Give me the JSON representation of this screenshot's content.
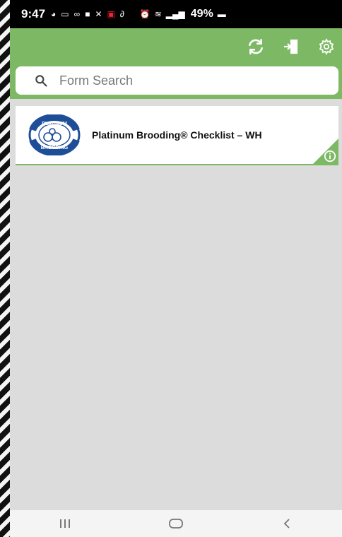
{
  "status_bar": {
    "time": "9:47",
    "battery": "49%"
  },
  "toolbar": {
    "actions": [
      {
        "icon": "sync-icon"
      },
      {
        "icon": "logout-icon"
      },
      {
        "icon": "settings-icon"
      }
    ]
  },
  "search": {
    "placeholder": "Form Search",
    "value": ""
  },
  "forms": [
    {
      "title": "Platinum Brooding® Checklist – WH",
      "logo_text_top": "PLATINUM",
      "logo_text_bottom": "BROODING"
    }
  ],
  "colors": {
    "accent": "#7db964",
    "background": "#dcdcdc",
    "logo_blue": "#1f4e99"
  }
}
